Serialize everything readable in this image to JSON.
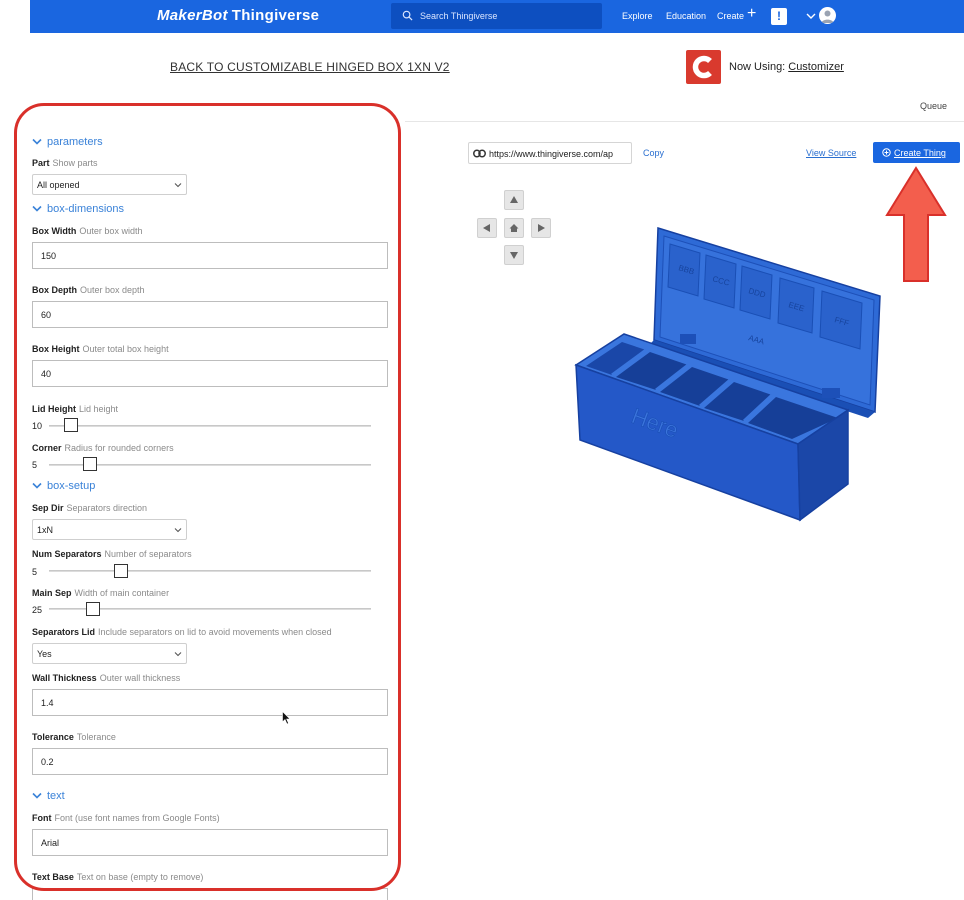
{
  "topbar": {
    "logo_makerbot": "MakerBot",
    "logo_thingiverse": "Thingiverse",
    "search_placeholder": "Search Thingiverse",
    "nav": {
      "explore": "Explore",
      "education": "Education",
      "create": "Create"
    },
    "bell_glyph": "!",
    "colors": {
      "bar": "#1a66e0",
      "search": "#0d4fc0"
    }
  },
  "header": {
    "back_link": "BACK TO CUSTOMIZABLE HINGED BOX 1XN V2",
    "now_using_label": "Now Using:",
    "now_using_app": "Customizer",
    "queue": "Queue"
  },
  "sections": {
    "parameters": "parameters",
    "box_dimensions": "box-dimensions",
    "box_setup": "box-setup",
    "text": "text"
  },
  "fields": {
    "part": {
      "label": "Part",
      "hint": "Show parts",
      "value": "All opened"
    },
    "box_width": {
      "label": "Box Width",
      "hint": "Outer box width",
      "value": "150"
    },
    "box_depth": {
      "label": "Box Depth",
      "hint": "Outer box depth",
      "value": "60"
    },
    "box_height": {
      "label": "Box Height",
      "hint": "Outer total box height",
      "value": "40"
    },
    "lid_height": {
      "label": "Lid Height",
      "hint": "Lid height",
      "value": "10",
      "level": 0.05
    },
    "corner": {
      "label": "Corner",
      "hint": "Radius for rounded corners",
      "value": "5",
      "level": 0.11
    },
    "sep_dir": {
      "label": "Sep Dir",
      "hint": "Separators direction",
      "value": "1xN"
    },
    "num_separators": {
      "label": "Num Separators",
      "hint": "Number of separators",
      "value": "5",
      "level": 0.21
    },
    "main_sep": {
      "label": "Main Sep",
      "hint": "Width of main container",
      "value": "25",
      "level": 0.12
    },
    "separators_lid": {
      "label": "Separators Lid",
      "hint": "Include separators on lid to avoid movements when closed",
      "value": "Yes"
    },
    "wall_thickness": {
      "label": "Wall Thickness",
      "hint": "Outer wall thickness",
      "value": "1.4"
    },
    "tolerance": {
      "label": "Tolerance",
      "hint": "Tolerance",
      "value": "0.2"
    },
    "font": {
      "label": "Font",
      "hint": "Font (use font names from Google Fonts)",
      "value": "Arial"
    },
    "text_base": {
      "label": "Text Base",
      "hint": "Text on base (empty to remove)"
    }
  },
  "preview": {
    "share_url": "https://www.thingiverse.com/ap",
    "copy": "Copy",
    "view_source": "View Source",
    "create_thing": "Create Thing",
    "box_label_front": "Here",
    "lid_labels": [
      "BBB",
      "CCC",
      "DDD",
      "EEE",
      "FFF",
      "AAA"
    ]
  },
  "colors": {
    "accent": "#1a66e0",
    "section": "#3a82d8",
    "annotation": "#d9302a",
    "model": "#1f58c4"
  }
}
